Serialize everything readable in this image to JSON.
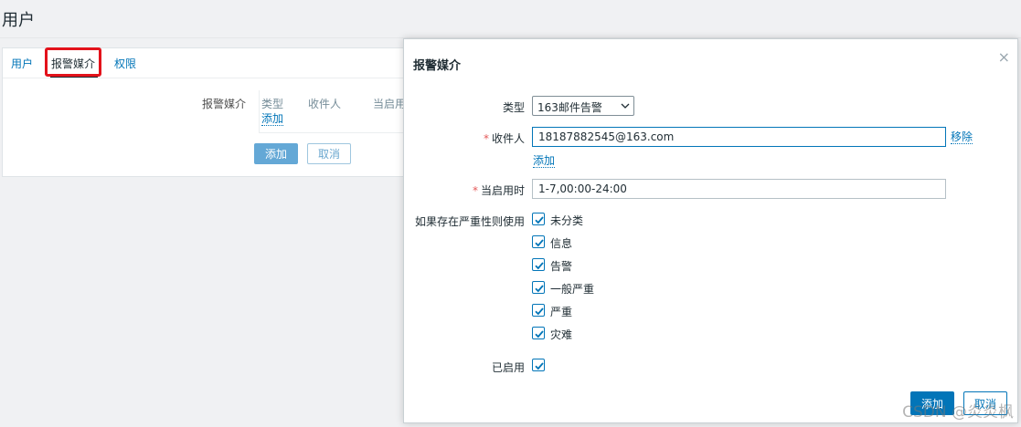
{
  "page": {
    "title": "用户"
  },
  "tabs": [
    {
      "label": "用户"
    },
    {
      "label": "报警媒介"
    },
    {
      "label": "权限"
    }
  ],
  "media_section": {
    "label": "报警媒介",
    "columns": [
      "类型",
      "收件人",
      "当启用"
    ],
    "add_link": "添加",
    "add_button": "添加",
    "cancel_button": "取消"
  },
  "dialog": {
    "title": "报警媒介",
    "type_label": "类型",
    "type_value": "163邮件告警",
    "recipient_label": "收件人",
    "recipient_value": "18187882545@163.com",
    "remove_link": "移除",
    "add_link": "添加",
    "active_label": "当启用时",
    "active_value": "1-7,00:00-24:00",
    "severity_label": "如果存在严重性则使用",
    "severities": [
      {
        "label": "未分类",
        "checked": true
      },
      {
        "label": "信息",
        "checked": true
      },
      {
        "label": "告警",
        "checked": true
      },
      {
        "label": "一般严重",
        "checked": true
      },
      {
        "label": "严重",
        "checked": true
      },
      {
        "label": "灾难",
        "checked": true
      }
    ],
    "enabled_label": "已启用",
    "enabled": true,
    "add_button": "添加",
    "cancel_button": "取消",
    "close_glyph": "×"
  },
  "watermark": "CSDN @炎炎枫",
  "colors": {
    "accent": "#0275b8",
    "highlight": "#e3121b",
    "required": "#e45959"
  }
}
